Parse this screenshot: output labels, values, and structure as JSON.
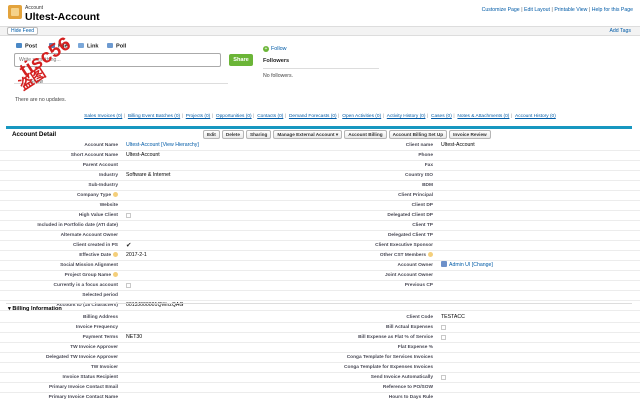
{
  "header": {
    "kind": "Account",
    "title": "Ultest-Account",
    "links": [
      "Customize Page",
      "Edit Layout",
      "Printable View",
      "Help for this Page"
    ],
    "link_sep": " | "
  },
  "feedbar": {
    "hide_feed": "Hide Feed",
    "add_tags": "Add Tags"
  },
  "feed": {
    "tabs": [
      "Post",
      "File",
      "Link",
      "Poll"
    ],
    "placeholder": "Write something...",
    "share": "Share",
    "follow": "Follow",
    "followers_title": "Followers",
    "no_followers": "No followers.",
    "show": "Show",
    "no_updates": "There are no updates."
  },
  "watermark": {
    "main": "tisc56",
    "sub": "盗图"
  },
  "related_links": [
    "Sales Invoices (0)",
    "Billing Event Batches (0)",
    "Projects (0)",
    "Opportunities (0)",
    "Contacts (0)",
    "Demand Forecasts (0)",
    "Open Activities (0)",
    "Activity History (0)",
    "Cases (0)",
    "Notes & Attachments (0)",
    "Account History (0)"
  ],
  "detail": {
    "title": "Account Detail",
    "buttons": [
      "Edit",
      "Delete",
      "Sharing",
      "Manage External Account ▾",
      "Account Billing",
      "Account Billing Set Up",
      "Invoice Review"
    ],
    "rows": [
      {
        "l": "Account Name",
        "lv": "Ultest-Account [View Hierarchy]",
        "r": "Client name",
        "rv": "Ultest-Account"
      },
      {
        "l": "Short Account Name",
        "lv": "Ultest-Account",
        "r": "Phone",
        "rv": ""
      },
      {
        "l": "Parent Account",
        "lv": "",
        "r": "Fax",
        "rv": ""
      },
      {
        "l": "Industry",
        "lv": "Software & Internet",
        "r": "Country ISO",
        "rv": ""
      },
      {
        "l": "Sub-Industry",
        "lv": "",
        "r": "BDM",
        "rv": ""
      },
      {
        "l": "Company Type",
        "lv": "",
        "r": "Client Principal",
        "rv": ""
      },
      {
        "l": "Website",
        "lv": "",
        "r": "Client DP",
        "rv": ""
      },
      {
        "l": "High Value Client",
        "lv": "",
        "r": "Delegated Client DP",
        "rv": ""
      },
      {
        "l": "Included in Portfolio date (ATI date)",
        "lv": "",
        "r": "Client TP",
        "rv": ""
      },
      {
        "l": "Alternate Account Owner",
        "lv": "",
        "r": "Delegated Client TP",
        "rv": ""
      },
      {
        "l": "Client created in PS",
        "lv": "✔",
        "r": "Client Executive Sponsor",
        "rv": ""
      },
      {
        "l": "Effective Date",
        "lv": "2017-2-1",
        "r": "Other CST Members",
        "rv": ""
      },
      {
        "l": "Social Mission Alignment",
        "lv": "",
        "r": "Account Owner",
        "rv": "Admin UI [Change]"
      },
      {
        "l": "Project Group Name",
        "lv": "",
        "r": "Joint Account Owner",
        "rv": ""
      },
      {
        "l": "Currently is a focus account",
        "lv": "",
        "r": "Previous CP",
        "rv": ""
      },
      {
        "l": "Selected period",
        "lv": "",
        "r": "",
        "rv": ""
      },
      {
        "l": "Account ID (18 Characters)",
        "lv": "0013J000001QWnzQAG",
        "r": "",
        "rv": ""
      }
    ]
  },
  "billing": {
    "title": "Billing Information",
    "rows": [
      {
        "l": "Billing Address",
        "lv": "",
        "r": "Client Code",
        "rv": "TESTACC"
      },
      {
        "l": "Invoice Frequency",
        "lv": "",
        "r": "Bill Actual Expenses",
        "rv": ""
      },
      {
        "l": "Payment Terms",
        "lv": "NET30",
        "r": "Bill Expense as Flat % of Service",
        "rv": ""
      },
      {
        "l": "TW Invoice Approver",
        "lv": "",
        "r": "Flat Expense %",
        "rv": ""
      },
      {
        "l": "Delegated TW Invoice Approver",
        "lv": "",
        "r": "Conga Template for Services Invoices",
        "rv": ""
      },
      {
        "l": "TW Invoicer",
        "lv": "",
        "r": "Conga Template for Expenses Invoices",
        "rv": ""
      },
      {
        "l": "Invoice Status Recipient",
        "lv": "",
        "r": "Send Invoice Automatically",
        "rv": ""
      },
      {
        "l": "Primary Invoice Contact Email",
        "lv": "",
        "r": "Reference to PO/SOW",
        "rv": ""
      },
      {
        "l": "Primary Invoice Contact Name",
        "lv": "",
        "r": "Hours to Days Rule",
        "rv": ""
      }
    ]
  },
  "colors": {
    "link": "#015ba7",
    "panel_accent": "#1797c0",
    "share": "#6bb537",
    "watermark": "#d42020"
  }
}
